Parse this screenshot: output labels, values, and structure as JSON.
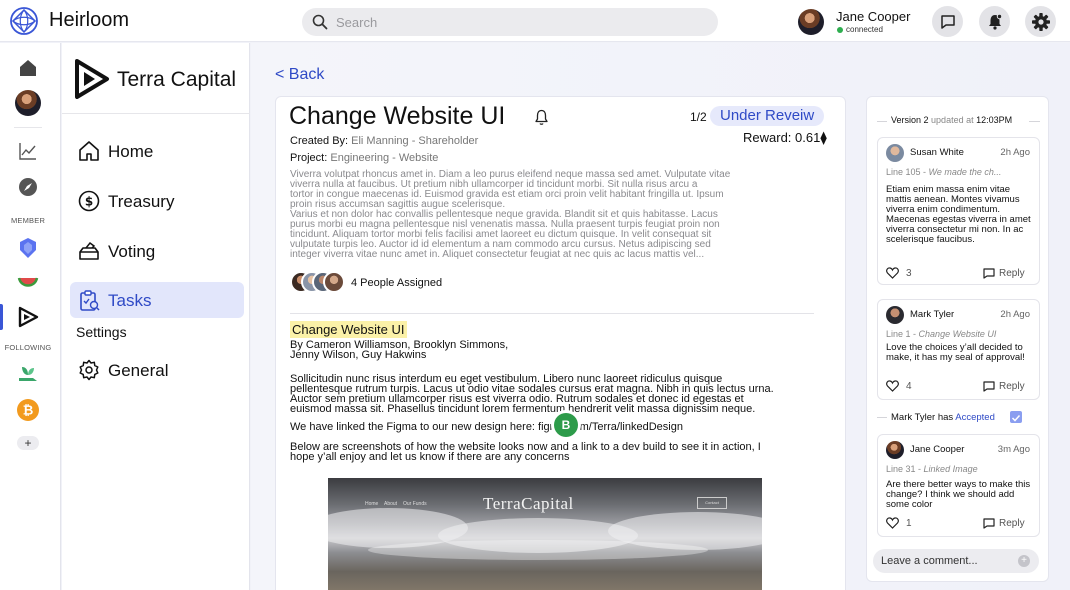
{
  "app": {
    "name": "Heirloom"
  },
  "search": {
    "placeholder": "Search"
  },
  "user": {
    "name": "Jane Cooper",
    "status": "connected"
  },
  "rail": {
    "member_label": "MEMBER",
    "following_label": "FOLLOWING",
    "add_label": "+"
  },
  "org": {
    "name": "Terra Capital"
  },
  "nav": {
    "items": [
      {
        "label": "Home",
        "icon": "home-icon"
      },
      {
        "label": "Treasury",
        "icon": "dollar-icon"
      },
      {
        "label": "Voting",
        "icon": "ballot-icon"
      },
      {
        "label": "Tasks",
        "icon": "clipboard-icon",
        "active": true
      }
    ],
    "settings_label": "Settings",
    "general_label": "General"
  },
  "back_label": "< Back",
  "task": {
    "title": "Change Website UI",
    "page": "1/2",
    "status": "Under Reveiw",
    "reward": "Reward: 0.61",
    "reward_symbol": "⧫",
    "created_by_label": "Created By:",
    "created_by": "Eli Manning - Shareholder",
    "project_label": "Project:",
    "project": "Engineering - Website",
    "description": [
      "Viverra volutpat rhoncus amet in. Diam a leo purus eleifend neque massa sed amet. Vulputate vitae",
      "viverra nulla at faucibus. Ut pretium nibh ullamcorper id tincidunt morbi. Sit nulla risus arcu a",
      "tortor in congue maecenas id. Euismod gravida est etiam orci proin velit habitant fringilla ut. Ipsum",
      "proin risus accumsan sagittis augue scelerisque.",
      "Varius et non dolor hac convallis pellentesque neque gravida. Blandit sit et quis habitasse. Lacus",
      "purus morbi eu magna pellentesque nisl venenatis massa. Nulla praesent turpis feugiat proin non",
      "tincidunt. Aliquam tortor morbi felis facilisi amet laoreet eu dictum quisque. In velit consequat sit",
      "vulputate turpis leo. Auctor id id elementum a nam commodo arcu cursus. Netus adipiscing sed",
      "integer viverra vitae nunc amet in. Aliquet consectetur feugiat at nec quis ac lacus mattis vel..."
    ],
    "assigned": "4 People Assigned",
    "doc": {
      "title": "Change Website UI",
      "by": "By Cameron Williamson, Brooklyn Simmons, Jenny Wilson, Guy Hakwins",
      "body1": [
        "Sollicitudin nunc risus interdum eu eget vestibulum. Libero nunc laoreet ridiculus quisque",
        "pellentesque rutrum turpis. Lacus ut odio vitae sodales cursus erat magna. Nibh in quis lectus urna.",
        "Auctor sem pretium ullamcorper risus est viverra odio. Rutrum sodales et donec id egestas et",
        "euismod massa sit. Phasellus tincidunt lorem fermentum hendrerit velit massa dignissim neque."
      ],
      "figma_line": "We have linked the Figma to our new design here:  figma.com/Terra/linkedDesign",
      "cursor_badge": "B",
      "body2": [
        "Below are screenshots of how the website looks now and a link to a dev build to see it in action, I",
        "hope y’all enjoy and let us know if there are any concerns"
      ],
      "screenshot": {
        "nav": [
          "Home",
          "About",
          "Our Funds"
        ],
        "title": "TerraCapital",
        "button": "Contact"
      }
    }
  },
  "panel": {
    "version": {
      "label": "Version 2",
      "updated": "updated at",
      "time": "12:03PM"
    },
    "comments": [
      {
        "name": "Susan White",
        "time": "2h Ago",
        "line": "Line 105 -",
        "ref": "We made the ch...",
        "body": "Etiam enim massa enim vitae mattis aenean. Montes vivamus viverra enim condimentum. Maecenas egestas viverra in amet viverra consectetur mi non. In ac scelerisque faucibus.",
        "likes": "3",
        "reply": "Reply"
      },
      {
        "name": "Mark Tyler",
        "time": "2h Ago",
        "line": "Line 1 -",
        "ref": "Change Website UI",
        "body": "Love the choices y’all decided to make, it has my seal of approval!",
        "likes": "4",
        "reply": "Reply"
      },
      {
        "name": "Jane Cooper",
        "time": "3m Ago",
        "line": "Line 31 -",
        "ref": "Linked Image",
        "body": "Are there better ways to make this change? I think we should add some color",
        "likes": "1",
        "reply": "Reply"
      }
    ],
    "accepted": {
      "name": "Mark Tyler",
      "has": "has",
      "status": "Accepted"
    },
    "comment_placeholder": "Leave a comment..."
  },
  "colors": {
    "accent": "#2f4ac6",
    "highlight": "#fbf1a8",
    "online": "#2eae4f",
    "cursor_badge": "#2d9b4a"
  }
}
